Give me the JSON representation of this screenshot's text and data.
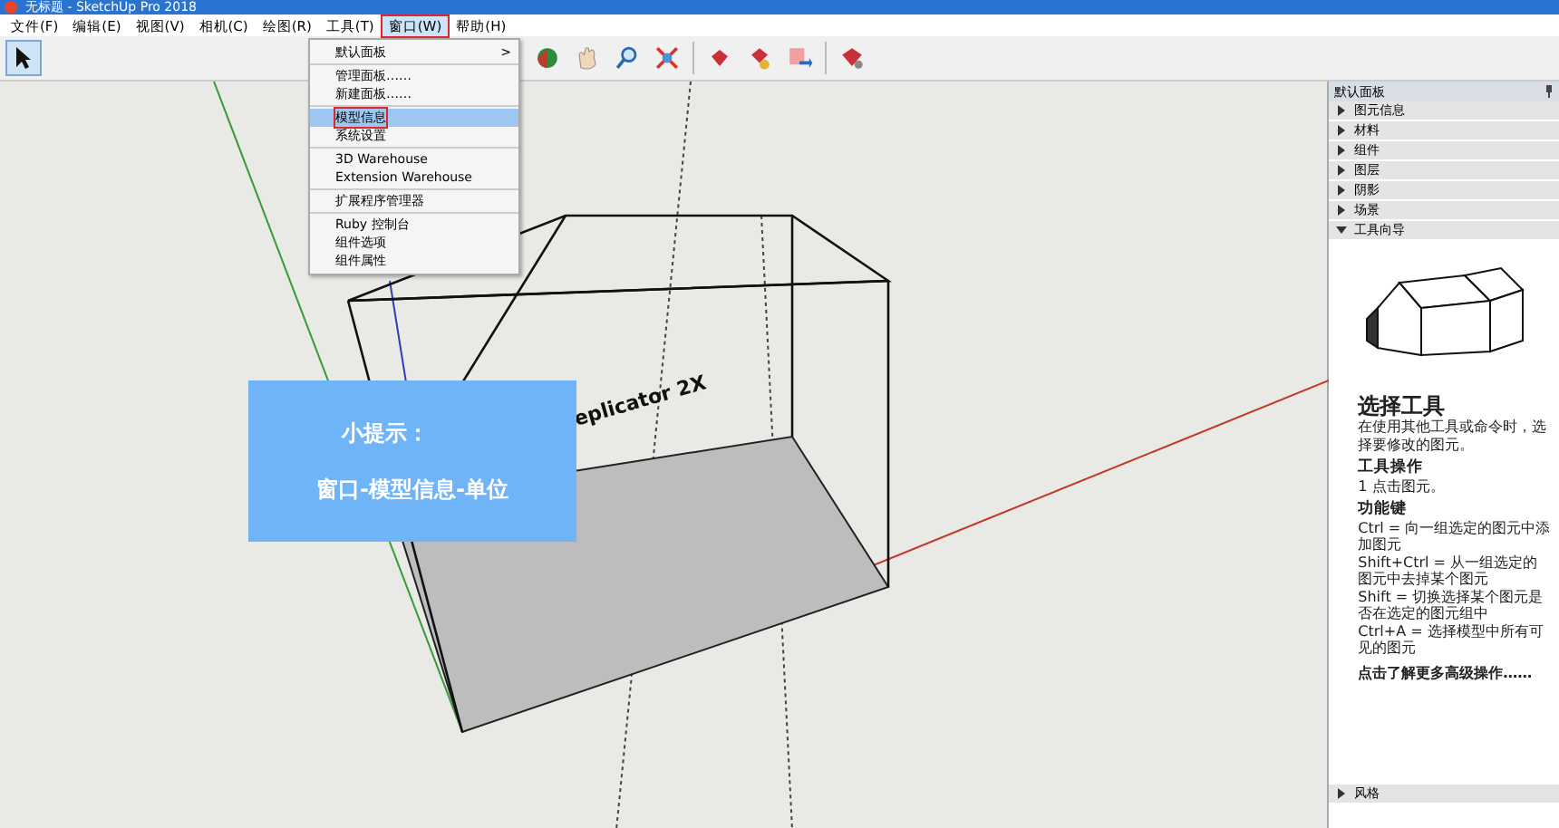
{
  "window": {
    "title": "无标题 - SketchUp Pro 2018"
  },
  "menu_bar": [
    {
      "label": "文件(F)",
      "selected": false
    },
    {
      "label": "编辑(E)",
      "selected": false
    },
    {
      "label": "视图(V)",
      "selected": false
    },
    {
      "label": "相机(C)",
      "selected": false
    },
    {
      "label": "绘图(R)",
      "selected": false
    },
    {
      "label": "工具(T)",
      "selected": false
    },
    {
      "label": "窗口(W)",
      "selected": true
    },
    {
      "label": "帮助(H)",
      "selected": false
    }
  ],
  "toolbar": {
    "select_tool": {
      "selected": true
    }
  },
  "dropdown": {
    "groups": [
      {
        "items": [
          {
            "label": "默认面板",
            "arrow": ">",
            "selected": false
          }
        ]
      },
      {
        "items": [
          {
            "label": "管理面板……",
            "selected": false
          },
          {
            "label": "新建面板……",
            "selected": false
          }
        ]
      },
      {
        "items": [
          {
            "label": "模型信息",
            "selected": true
          },
          {
            "label": "系统设置",
            "selected": false
          }
        ]
      },
      {
        "items": [
          {
            "label": "3D Warehouse",
            "selected": false
          },
          {
            "label": "Extension Warehouse",
            "selected": false
          }
        ]
      },
      {
        "items": [
          {
            "label": "扩展程序管理器",
            "selected": false
          }
        ]
      },
      {
        "items": [
          {
            "label": "Ruby 控制台",
            "selected": false
          },
          {
            "label": "组件选项",
            "selected": false
          },
          {
            "label": "组件属性",
            "selected": false
          }
        ]
      }
    ]
  },
  "canvas": {
    "model_label": "eplicator 2X",
    "tip": {
      "title": "小提示：",
      "text": "窗口-模型信息-单位"
    }
  },
  "panel": {
    "title": "默认面板",
    "trays": [
      {
        "label": "图元信息",
        "expanded": false
      },
      {
        "label": "材料",
        "expanded": false
      },
      {
        "label": "组件",
        "expanded": false
      },
      {
        "label": "图层",
        "expanded": false
      },
      {
        "label": "阴影",
        "expanded": false
      },
      {
        "label": "场景",
        "expanded": false
      },
      {
        "label": "工具向导",
        "expanded": true
      }
    ],
    "guide": {
      "title": "选择工具",
      "intro": "在使用其他工具或命令时，选择要修改的图元。",
      "sections": [
        {
          "heading": "工具操作",
          "lines": [
            "1 点击图元。"
          ]
        },
        {
          "heading": "功能键",
          "lines": [
            "Ctrl = 向一组选定的图元中添加图元",
            "Shift+Ctrl = 从一组选定的图元中去掉某个图元",
            "Shift = 切换选择某个图元是否在选定的图元组中",
            "Ctrl+A = 选择模型中所有可见的图元"
          ]
        }
      ],
      "link": "点击了解更多高级操作……"
    },
    "bottom_trays": [
      {
        "label": "风格",
        "expanded": false
      }
    ]
  }
}
